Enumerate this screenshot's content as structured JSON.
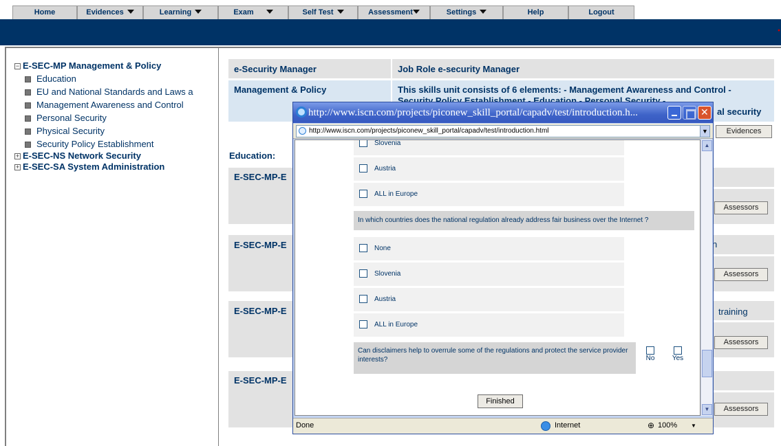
{
  "nav": {
    "items": [
      {
        "label": "Home",
        "dropdown": false
      },
      {
        "label": "Evidences",
        "dropdown": true
      },
      {
        "label": "Learning",
        "dropdown": true
      },
      {
        "label": "Exam",
        "dropdown": true
      },
      {
        "label": "Self Test",
        "dropdown": true
      },
      {
        "label": "Assessment",
        "dropdown": true
      },
      {
        "label": "Settings",
        "dropdown": true
      },
      {
        "label": "Help",
        "dropdown": false
      },
      {
        "label": "Logout",
        "dropdown": false
      }
    ]
  },
  "tree": {
    "root1": {
      "code": "E-SEC-MP Management & Policy",
      "expanded": true
    },
    "leaves": [
      "Education",
      "EU and National Standards and Laws a",
      "Management Awareness and Control",
      "Personal Security",
      "Physical Security",
      "Security Policy Establishment"
    ],
    "root2": {
      "code": "E-SEC-NS Network Security",
      "expanded": false
    },
    "root3": {
      "code": "E-SEC-SA System Administration",
      "expanded": false
    }
  },
  "main": {
    "job_label": "e-Security Manager",
    "job_role": "Job Role e-security Manager",
    "unit_label": "Management & Policy",
    "unit_desc": "This skills unit consists of 6 elements: - Management Awareness and Control - Security Policy Establishment - Education - Personal Security -",
    "unit_desc_tail": "al security",
    "evidences_button": "Evidences",
    "section_title": "Education:",
    "rows": [
      {
        "code": "E-SEC-MP-E",
        "tail": "",
        "assessors": "Assessors"
      },
      {
        "code": "E-SEC-MP-E",
        "tail": "n",
        "assessors": "Assessors"
      },
      {
        "code": "E-SEC-MP-E",
        "tail": "training",
        "assessors": "Assessors"
      },
      {
        "code": "E-SEC-MP-E",
        "tail": "",
        "assessors": "Assessors"
      }
    ]
  },
  "popup": {
    "title": "http://www.iscn.com/projects/piconew_skill_portal/capadv/test/introduction.h...",
    "address": "http://www.iscn.com/projects/piconew_skill_portal/capadv/test/introduction.html",
    "options_top": [
      "Slovenia",
      "Austria",
      "ALL in Europe"
    ],
    "question1": "In which countries does the national regulation already address fair business over the Internet ?",
    "options_q1": [
      "None",
      "Slovenia",
      "Austria",
      "ALL in Europe"
    ],
    "question2": "Can disclaimers help to overrule some of the regulations and protect the service provider interests?",
    "q2_no": "No",
    "q2_yes": "Yes",
    "finished_button": "Finished",
    "status_left": "Done",
    "status_zone": "Internet",
    "zoom": "100%"
  }
}
